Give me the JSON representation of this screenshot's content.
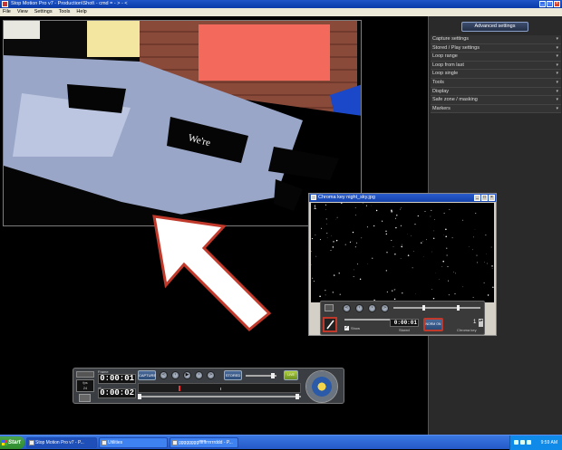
{
  "window": {
    "title": "Stop Motion Pro v7 - Production\\Shot\\ - cmd = - > - <"
  },
  "menu": [
    "File",
    "View",
    "Settings",
    "Tools",
    "Help"
  ],
  "preview": {
    "caption": "We're"
  },
  "panel": {
    "advanced_button": "Advanced settings",
    "items": [
      "Capture settings",
      "Stored / Play settings",
      "Loop range",
      "Loop from last",
      "Loop single",
      "Tools",
      "Display",
      "Safe zone / masking",
      "Markers"
    ]
  },
  "chroma": {
    "title": "Chroma key  night_sky.jpg",
    "frame_index": "1",
    "time": "0:00:01",
    "stored_label": "Stored",
    "show_label": "Show",
    "mode_btn": "NORM ON",
    "key_value": "1",
    "key_label": "Chroma key",
    "highlight_color": "#c0392b"
  },
  "transport": {
    "fps_label": "fps",
    "fps_value": "24",
    "frame_label": "Frame",
    "time_top": "0:00:01",
    "of_label": "of",
    "time_bottom": "0:00:02",
    "capture_btn": "CAPTURE",
    "preview_btn": "PREVIEW",
    "stored_btn": "STORED",
    "live_btn": "LIVE"
  },
  "taskbar": {
    "start": "Start",
    "tasks": [
      "Stop Motion Pro v7 - P...",
      "Utilities",
      "ggggggggffffffrrrrrrddd - P..."
    ],
    "clock": "9:59 AM"
  }
}
